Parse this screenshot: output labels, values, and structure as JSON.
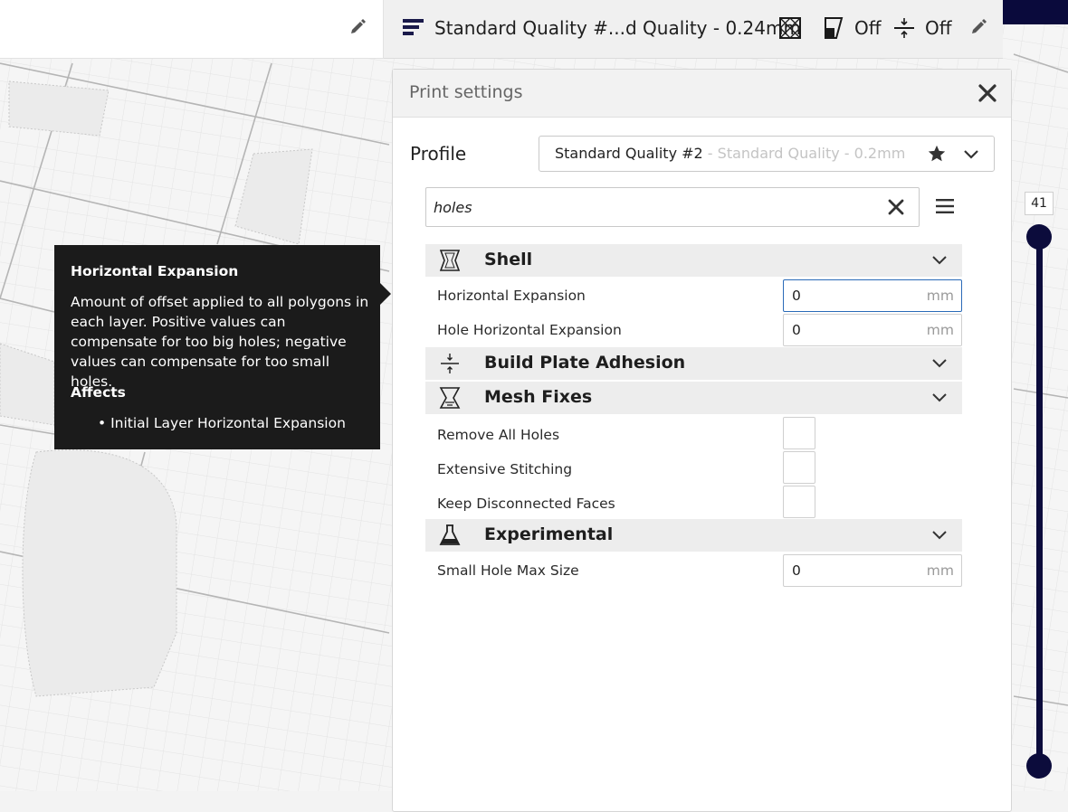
{
  "header": {
    "profile_summary": "Standard Quality #...d Quality - 0.24mm",
    "support_status": "Off",
    "adhesion_status": "Off"
  },
  "panel": {
    "title": "Print settings",
    "profile_label": "Profile",
    "profile_name": "Standard Quality #2",
    "profile_sub": " - Standard Quality - 0.2mm",
    "search_value": "holes"
  },
  "sections": {
    "shell": "Shell",
    "adhesion": "Build Plate Adhesion",
    "mesh_fixes": "Mesh Fixes",
    "experimental": "Experimental"
  },
  "settings": {
    "horizontal_expansion": {
      "label": "Horizontal Expansion",
      "value": "0",
      "unit": "mm"
    },
    "hole_horizontal_expansion": {
      "label": "Hole Horizontal Expansion",
      "value": "0",
      "unit": "mm"
    },
    "remove_all_holes": {
      "label": "Remove All Holes",
      "checked": false
    },
    "extensive_stitching": {
      "label": "Extensive Stitching",
      "checked": false
    },
    "keep_disconnected_faces": {
      "label": "Keep Disconnected Faces",
      "checked": false
    },
    "small_hole_max_size": {
      "label": "Small Hole Max Size",
      "value": "0",
      "unit": "mm"
    }
  },
  "tooltip": {
    "title": "Horizontal Expansion",
    "body": "Amount of offset applied to all polygons in each layer. Positive values can compensate for too big holes; negative values can compensate for too small holes.",
    "affects_heading": "Affects",
    "affects_item": "• Initial Layer Horizontal Expansion"
  },
  "layer_slider": {
    "top_value": "41"
  },
  "icons": {
    "edit": "pencil-icon",
    "profile": "layer-height-icon",
    "infill": "infill-icon",
    "support": "support-icon",
    "adhesion": "adhesion-icon",
    "close": "close-icon",
    "favorite": "star-icon",
    "dropdown": "chevron-down-icon",
    "clear": "clear-search-icon",
    "menu": "hamburger-menu-icon",
    "shell": "shell-icon",
    "mesh_fixes": "mesh-fixes-icon",
    "experimental": "flask-icon"
  },
  "colors": {
    "accent": "#0c0c3c",
    "focus": "#2a6ab8",
    "tooltip_bg": "#1b1b1b"
  }
}
